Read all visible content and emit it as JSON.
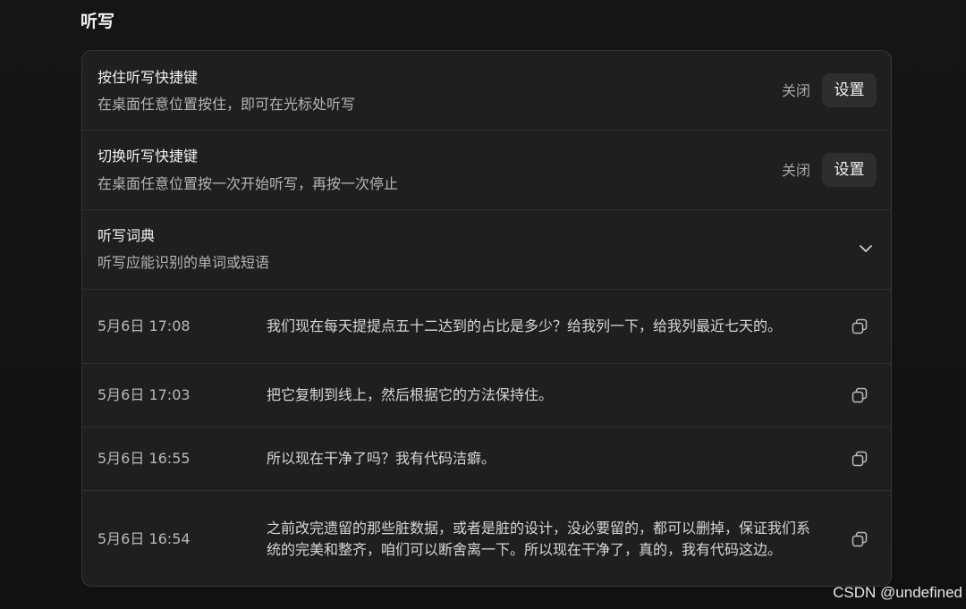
{
  "section": {
    "title": "听写"
  },
  "settings": [
    {
      "title": "按住听写快捷键",
      "description": "在桌面任意位置按住，即可在光标处听写",
      "status": "关闭",
      "button": "设置"
    },
    {
      "title": "切换听写快捷键",
      "description": "在桌面任意位置按一次开始听写，再按一次停止",
      "status": "关闭",
      "button": "设置"
    },
    {
      "title": "听写词典",
      "description": "听写应能识别的单词或短语"
    }
  ],
  "history": [
    {
      "time": "5月6日 17:08",
      "text": "我们现在每天提提点五十二达到的占比是多少？给我列一下，给我列最近七天的。"
    },
    {
      "time": "5月6日 17:03",
      "text": "把它复制到线上，然后根据它的方法保持住。"
    },
    {
      "time": "5月6日 16:55",
      "text": "所以现在干净了吗？我有代码洁癖。"
    },
    {
      "time": "5月6日 16:54",
      "text": "之前改完遗留的那些脏数据，或者是脏的设计，没必要留的，都可以删掉，保证我们系统的完美和整齐，咱们可以断舍离一下。所以现在干净了，真的，我有代码这边。"
    }
  ],
  "watermark": "CSDN @undefined"
}
